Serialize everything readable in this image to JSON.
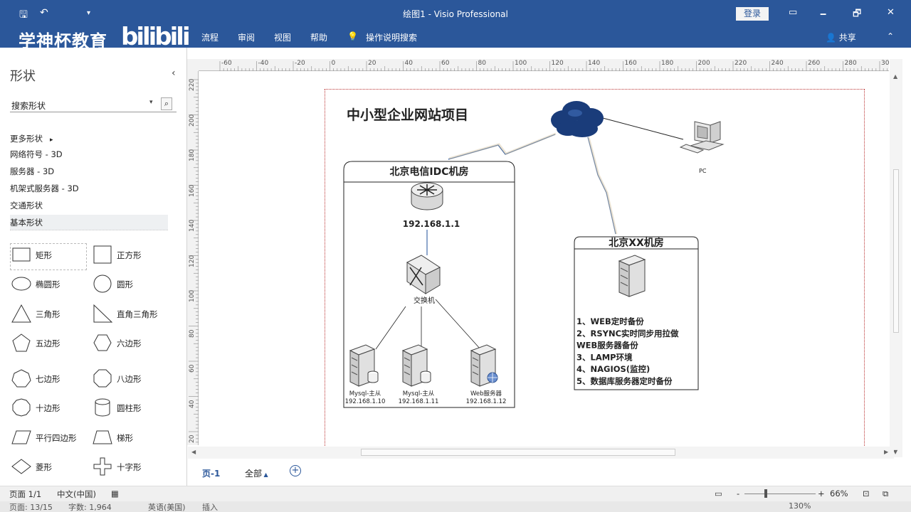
{
  "window": {
    "title": "绘图1  -  Visio Professional",
    "login": "登录",
    "minimize": "🗕",
    "restore": "🗗",
    "close": "✕"
  },
  "quick_access": {
    "save": "🖫",
    "undo": "↶",
    "customize": "▾"
  },
  "ribbon": {
    "brand_text": "学神杯教育",
    "brand_logo": "bilibili",
    "tabs": [
      "流程",
      "审阅",
      "视图",
      "帮助"
    ],
    "tell_me": "操作说明搜索",
    "share": "共享",
    "collapse": "⌃"
  },
  "shapes_pane": {
    "title": "形状",
    "collapse": "‹",
    "search_placeholder": "搜索形状",
    "stencils": [
      "更多形状",
      "网络符号 - 3D",
      "服务器 - 3D",
      "机架式服务器 - 3D",
      "交通形状",
      "基本形状"
    ],
    "shapes": [
      "矩形",
      "正方形",
      "椭圆形",
      "圆形",
      "三角形",
      "直角三角形",
      "五边形",
      "六边形",
      "七边形",
      "八边形",
      "十边形",
      "圆柱形",
      "平行四边形",
      "梯形",
      "菱形",
      "十字形"
    ]
  },
  "rulers": {
    "horizontal": [
      "-60",
      "-40",
      "-20",
      "0",
      "20",
      "40",
      "60",
      "80",
      "100",
      "120",
      "140",
      "160",
      "180",
      "200",
      "220",
      "240",
      "260",
      "280",
      "300"
    ],
    "vertical": [
      "220",
      "200",
      "180",
      "160",
      "140",
      "120",
      "100",
      "80",
      "60",
      "40",
      "20"
    ]
  },
  "diagram": {
    "title": "中小型企业网站项目",
    "idc_room_title": "北京电信IDC机房",
    "router_ip": "192.168.1.1",
    "switch_label": "交换机",
    "servers": [
      {
        "name": "Mysql-主从",
        "ip": "192.168.1.10"
      },
      {
        "name": "Mysql-主从",
        "ip": "192.168.1.11"
      },
      {
        "name": "Web服务器",
        "ip": "192.168.1.12"
      }
    ],
    "pc_label": "PC",
    "xx_room_title": "北京XX机房",
    "xx_room_notes": [
      "1、WEB定时备份",
      "2、RSYNC实时同步用拉做",
      "WEB服务器备份",
      "3、LAMP环境",
      "4、NAGIOS(监控)",
      "5、数据库服务器定时备份"
    ]
  },
  "page_tabs": {
    "page1": "页-1",
    "all": "全部",
    "add": "+"
  },
  "statusbar": {
    "page": "页面 1/1",
    "language": "中文(中国)",
    "zoom": "66%",
    "zoom_minus": "-",
    "zoom_plus": "+"
  },
  "statusbar_secondary": {
    "page": "页面: 13/15",
    "words": "字数: 1,964",
    "language": "英语(美国)",
    "mode": "插入",
    "zoom": "130%"
  },
  "colors": {
    "ribbon": "#2b579a",
    "cloud": "#1a3c7a",
    "lightning": "#1f4f9a",
    "room_border": "#222222"
  }
}
